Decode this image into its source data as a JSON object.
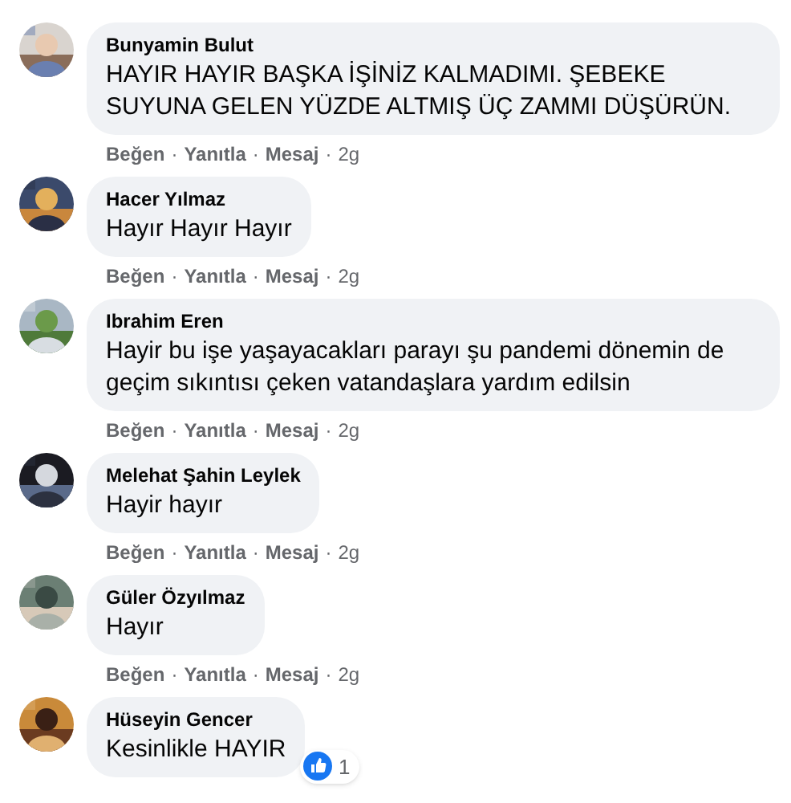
{
  "separator": "·",
  "comments": [
    {
      "author": "Bunyamin Bulut",
      "text": "HAYIR HAYIR BAŞKA İŞİNİZ KALMADIMI. ŞEBEKE SUYUNA GELEN YÜZDE ALTMIŞ ÜÇ ZAMMI DÜŞÜRÜN.",
      "actions": [
        "Beğen",
        "Yanıtla",
        "Mesaj"
      ],
      "time": "2g"
    },
    {
      "author": "Hacer Yılmaz",
      "text": "Hayır Hayır Hayır",
      "actions": [
        "Beğen",
        "Yanıtla",
        "Mesaj"
      ],
      "time": "2g"
    },
    {
      "author": "Ibrahim Eren",
      "text": "Hayir bu işe yaşayacakları parayı şu pandemi dönemin de geçim sıkıntısı çeken vatandaşlara yardım edilsin",
      "actions": [
        "Beğen",
        "Yanıtla",
        "Mesaj"
      ],
      "time": "2g"
    },
    {
      "author": "Melehat Şahin Leylek",
      "text": "Hayir hayır",
      "actions": [
        "Beğen",
        "Yanıtla",
        "Mesaj"
      ],
      "time": "2g"
    },
    {
      "author": "Güler Özyılmaz",
      "text": "Hayır",
      "actions": [
        "Beğen",
        "Yanıtla",
        "Mesaj"
      ],
      "time": "2g"
    },
    {
      "author": "Hüseyin Gencer",
      "text": "Kesinlikle HAYIR",
      "reactions": {
        "count": "1"
      }
    }
  ]
}
